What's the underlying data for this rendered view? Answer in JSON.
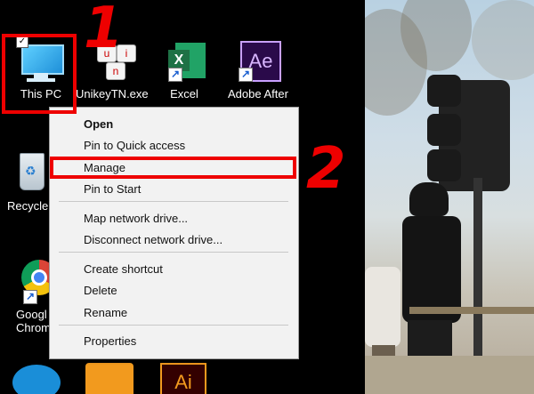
{
  "desktop": {
    "icons": [
      {
        "label": "This PC"
      },
      {
        "label": "UnikeyTN.exe"
      },
      {
        "label": "Excel",
        "glyph": "X"
      },
      {
        "label": "Adobe After",
        "glyph": "Ae"
      },
      {
        "label": "Recycle"
      },
      {
        "label": "Googl"
      },
      {
        "label": "Chrom"
      },
      {
        "label": "",
        "glyph": "Ai"
      }
    ],
    "unikey_keys": [
      "u",
      "n",
      "i"
    ]
  },
  "context_menu": {
    "items": [
      {
        "label": "Open"
      },
      {
        "label": "Pin to Quick access"
      },
      {
        "label": "Manage"
      },
      {
        "label": "Pin to Start"
      },
      {
        "label": "Map network drive..."
      },
      {
        "label": "Disconnect network drive..."
      },
      {
        "label": "Create shortcut"
      },
      {
        "label": "Delete"
      },
      {
        "label": "Rename"
      },
      {
        "label": "Properties"
      }
    ]
  },
  "annotations": {
    "step1": "1",
    "step2": "2"
  },
  "colors": {
    "highlight": "#e00000",
    "excel": "#1e7145",
    "after_effects": "#2a0a4a",
    "ai": "#f29a1e"
  }
}
